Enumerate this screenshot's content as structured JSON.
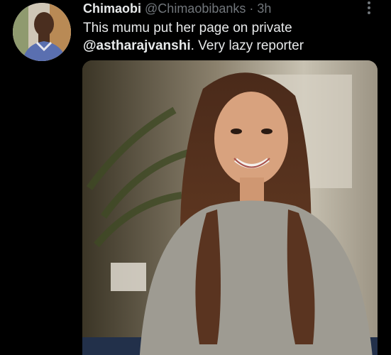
{
  "tweet": {
    "author_name": "Chimaobi",
    "author_handle": "@Chimaobibanks",
    "separator": "·",
    "timestamp": "3h",
    "text_line1": "This mumu put her page on private",
    "mention": "@astharajvanshi",
    "text_after_mention": ". Very lazy reporter",
    "more_icon": "more-vertical-icon",
    "avatar_icon": "profile-photo",
    "media_description_icon": "photo-woman-smiling"
  },
  "colors": {
    "background": "#000000",
    "primary_text": "#e7e9ea",
    "secondary_text": "#71767b"
  }
}
